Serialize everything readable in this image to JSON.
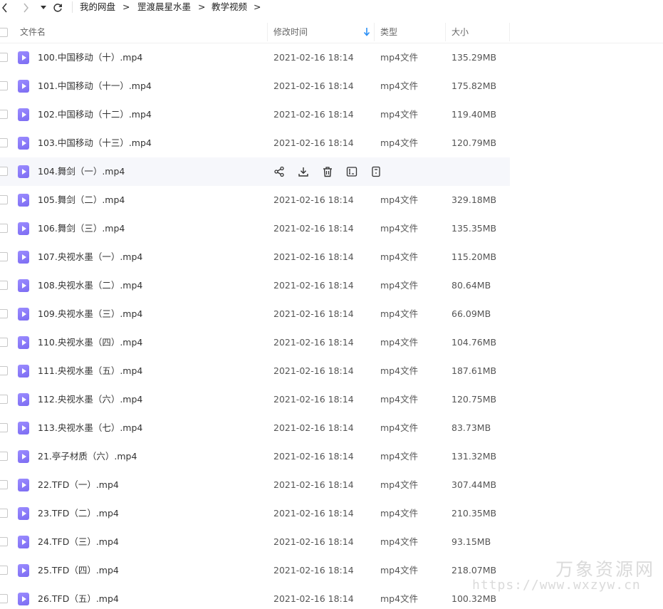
{
  "nav": {
    "breadcrumb": [
      "我的网盘",
      "罡渡晨星水墨",
      "教学视频"
    ],
    "separator": ">"
  },
  "header": {
    "name": "文件名",
    "modified": "修改时间",
    "type": "类型",
    "size": "大小"
  },
  "files": [
    {
      "name": "100.中国移动（十）.mp4",
      "date": "2021-02-16 18:14",
      "type": "mp4文件",
      "size": "135.29MB"
    },
    {
      "name": "101.中国移动（十一）.mp4",
      "date": "2021-02-16 18:14",
      "type": "mp4文件",
      "size": "175.82MB"
    },
    {
      "name": "102.中国移动（十二）.mp4",
      "date": "2021-02-16 18:14",
      "type": "mp4文件",
      "size": "119.40MB"
    },
    {
      "name": "103.中国移动（十三）.mp4",
      "date": "2021-02-16 18:14",
      "type": "mp4文件",
      "size": "120.79MB"
    },
    {
      "name": "104.舞剑（一）.mp4",
      "date": "",
      "type": "",
      "size": "",
      "hover": true
    },
    {
      "name": "105.舞剑（二）.mp4",
      "date": "2021-02-16 18:14",
      "type": "mp4文件",
      "size": "329.18MB"
    },
    {
      "name": "106.舞剑（三）.mp4",
      "date": "2021-02-16 18:14",
      "type": "mp4文件",
      "size": "135.35MB"
    },
    {
      "name": "107.央视水墨（一）.mp4",
      "date": "2021-02-16 18:14",
      "type": "mp4文件",
      "size": "115.20MB"
    },
    {
      "name": "108.央视水墨（二）.mp4",
      "date": "2021-02-16 18:14",
      "type": "mp4文件",
      "size": "80.64MB"
    },
    {
      "name": "109.央视水墨（三）.mp4",
      "date": "2021-02-16 18:14",
      "type": "mp4文件",
      "size": "66.09MB"
    },
    {
      "name": "110.央视水墨（四）.mp4",
      "date": "2021-02-16 18:14",
      "type": "mp4文件",
      "size": "104.76MB"
    },
    {
      "name": "111.央视水墨（五）.mp4",
      "date": "2021-02-16 18:14",
      "type": "mp4文件",
      "size": "187.61MB"
    },
    {
      "name": "112.央视水墨（六）.mp4",
      "date": "2021-02-16 18:14",
      "type": "mp4文件",
      "size": "120.75MB"
    },
    {
      "name": "113.央视水墨（七）.mp4",
      "date": "2021-02-16 18:14",
      "type": "mp4文件",
      "size": "83.73MB"
    },
    {
      "name": "21.亭子材质（六）.mp4",
      "date": "2021-02-16 18:14",
      "type": "mp4文件",
      "size": "131.32MB"
    },
    {
      "name": "22.TFD（一）.mp4",
      "date": "2021-02-16 18:14",
      "type": "mp4文件",
      "size": "307.44MB"
    },
    {
      "name": "23.TFD（二）.mp4",
      "date": "2021-02-16 18:14",
      "type": "mp4文件",
      "size": "210.35MB"
    },
    {
      "name": "24.TFD（三）.mp4",
      "date": "2021-02-16 18:14",
      "type": "mp4文件",
      "size": "93.15MB"
    },
    {
      "name": "25.TFD（四）.mp4",
      "date": "2021-02-16 18:14",
      "type": "mp4文件",
      "size": "218.07MB"
    },
    {
      "name": "26.TFD（五）.mp4",
      "date": "2021-02-16 18:14",
      "type": "mp4文件",
      "size": "100.32MB"
    }
  ],
  "row_actions": [
    "share-icon",
    "download-icon",
    "delete-icon",
    "rename-icon",
    "more-icon"
  ],
  "icons": {
    "file": "video-file-icon"
  },
  "colors": {
    "file_icon": "#8b7cf8",
    "sort_arrow": "#2b8ff5",
    "hover_row": "#f6f7fb"
  },
  "watermark": {
    "text": "万象资源网",
    "url": "https://www.wxzyw.cn"
  }
}
